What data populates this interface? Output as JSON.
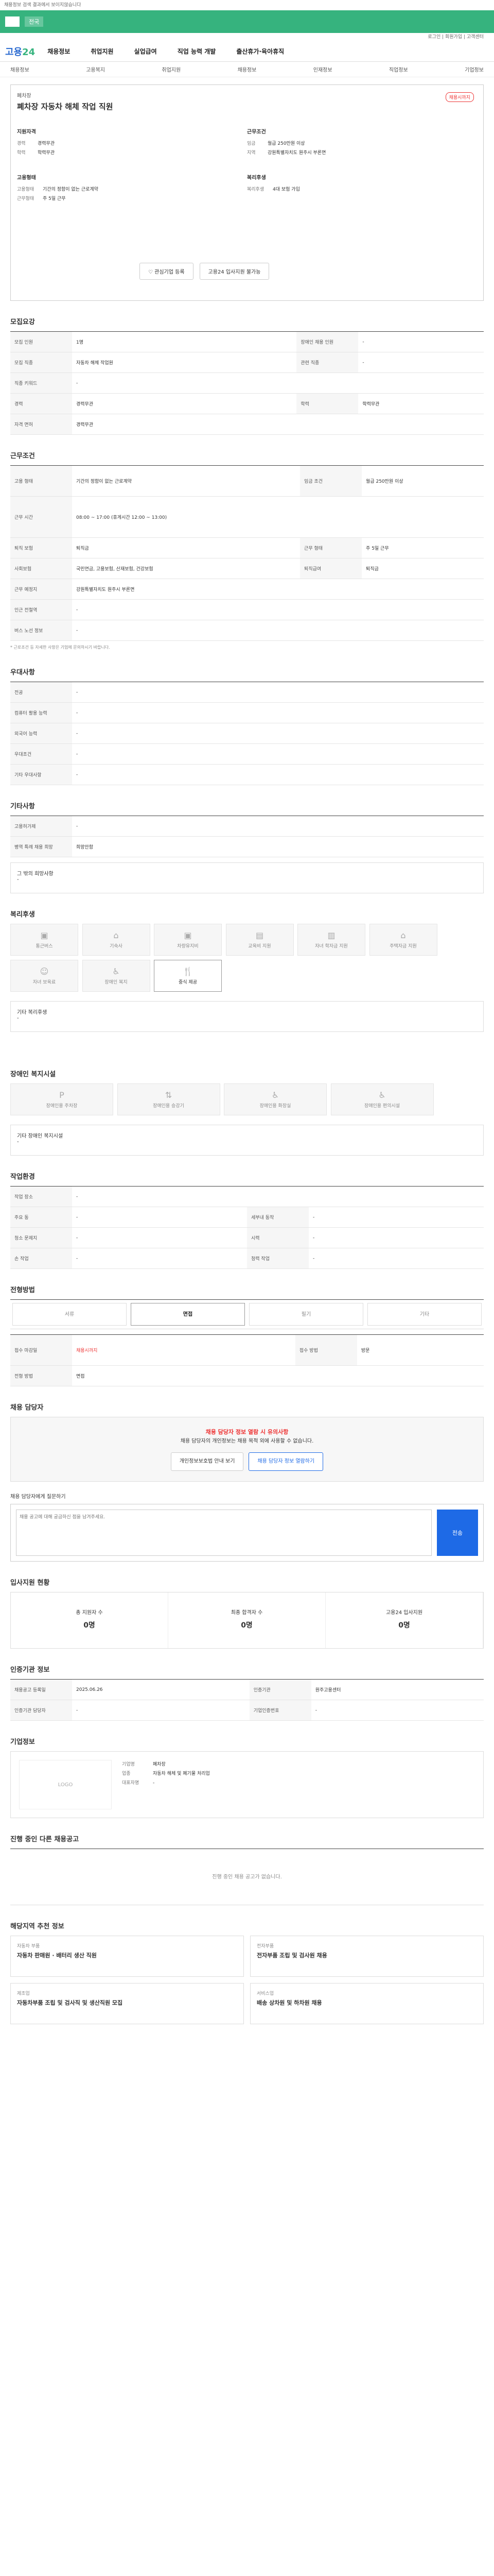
{
  "banner": "채용정보 검색 결과에서 보이지않습니다",
  "topbar": {
    "tag": "전국"
  },
  "util": "로그인 | 회원가입 | 고객센터",
  "header": {
    "logo_a": "고용",
    "logo_b": "24",
    "nav": [
      "채용정보",
      "취업지원",
      "실업급여",
      "직업 능력 개발",
      "출산휴가·육아휴직"
    ]
  },
  "subnav": [
    "채용정보",
    "고용복지",
    "취업지원",
    "채용정보",
    "인재정보",
    "직업정보",
    "기업정보"
  ],
  "summary": {
    "company": "폐차장",
    "title": "폐차장 자동차 해체 작업 직원",
    "urgent": "채용시까지",
    "left_h": "지원자격",
    "left": [
      {
        "k": "경력",
        "v": "경력무관"
      },
      {
        "k": "학력",
        "v": "학력무관"
      }
    ],
    "right_h": "근무조건",
    "right": [
      {
        "k": "임금",
        "v": "월급 250만원 이상"
      },
      {
        "k": "지역",
        "v": "강원특별자치도 원주시 부론면"
      }
    ],
    "left2_h": "고용형태",
    "left2": [
      {
        "k": "고용형태",
        "v": "기간의 정함이 없는 근로계약"
      },
      {
        "k": "근무형태",
        "v": "주 5일 근무"
      }
    ],
    "right2_h": "복리후생",
    "right2": [
      {
        "k": "복리후생",
        "v": "4대 보험 가입"
      }
    ],
    "btn_a": "관심기업 등록",
    "btn_b": "고용24 입사지원 불가능"
  },
  "recruit": {
    "h": "모집요강",
    "rows": [
      {
        "k": "모집 인원",
        "v": "1명",
        "k2": "장애인 채용 인원",
        "v2": "-"
      },
      {
        "k": "모집 직종",
        "v": "자동차 해체 작업원",
        "k2": "관련 직종",
        "v2": "-"
      },
      {
        "k": "직종 키워드",
        "v": "-"
      },
      {
        "k": "경력",
        "v": "경력무관",
        "k2": "학력",
        "v2": "학력무관"
      },
      {
        "k": "자격 면허",
        "v": "경력무관"
      }
    ]
  },
  "work": {
    "h": "근무조건",
    "rows": [
      {
        "k": "고용 형태",
        "v": "기간의 정함이 없는 근로계약",
        "k2": "임금 조건",
        "v2": "월급 250만원 이상"
      },
      {
        "k": "근무 시간",
        "v": "08:00 ~ 17:00 (휴게시간 12:00 ~ 13:00)"
      },
      {
        "k": "퇴직 보험",
        "v": "퇴직금",
        "k2": "근무 형태",
        "v2": "주 5일 근무"
      },
      {
        "k": "사회보험",
        "v": "국민연금, 고용보험, 산재보험, 건강보험",
        "k2": "퇴직급여",
        "v2": "퇴직금"
      },
      {
        "k": "근무 예정지",
        "v": "강원특별자치도 원주시 부론면"
      },
      {
        "k": "인근 전철역",
        "v": "-"
      },
      {
        "k": "버스 노선 정보",
        "v": "-"
      }
    ],
    "note": "* 근로조건 등 자세한 사항은 기업에 문의하시기 바랍니다."
  },
  "pref": {
    "h": "우대사항",
    "rows": [
      {
        "k": "전공",
        "v": "-"
      },
      {
        "k": "컴퓨터 활용 능력",
        "v": "-"
      },
      {
        "k": "외국어 능력",
        "v": "-"
      },
      {
        "k": "우대조건",
        "v": "-"
      },
      {
        "k": "기타 우대사항",
        "v": "-"
      }
    ]
  },
  "etc": {
    "h": "기타사항",
    "rows": [
      {
        "k": "고용허가제",
        "v": "-"
      },
      {
        "k": "병역 특례 채용 희망",
        "v": "희망안함"
      }
    ],
    "box": "그 밖의 희망사항",
    "box_v": "-"
  },
  "welfare": {
    "h": "복리후생",
    "items": [
      "통근버스",
      "기숙사",
      "차량유지비",
      "교육비 지원",
      "자녀 학자금 지원",
      "주택자금 지원",
      "자녀 보육료",
      "장애인 복지",
      "중식 제공"
    ],
    "box": "기타 복리후생",
    "box_v": "-"
  },
  "disab": {
    "h": "장애인 복지시설",
    "items": [
      "장애인용 주차장",
      "장애인용 승강기",
      "장애인용 화장실",
      "장애인용 편의시설"
    ],
    "box": "기타 장애인 복지시설",
    "box_v": "-"
  },
  "workenv": {
    "h": "작업환경",
    "rows": [
      {
        "k": "작업 장소",
        "v": "-"
      },
      {
        "k": "주요 동",
        "v": "-",
        "k2": "세부내 동작",
        "v2": "-"
      },
      {
        "k": "청소 문제지",
        "v": "-",
        "k2": "시력",
        "v2": "-"
      },
      {
        "k": "손 작업",
        "v": "-",
        "k2": "청력 작업",
        "v2": "-"
      }
    ]
  },
  "process": {
    "h": "전형방법",
    "tabs": [
      "서류",
      "면접",
      "필기",
      "기타"
    ],
    "rows": [
      {
        "k": "접수 마감일",
        "v": "채용시까지",
        "k2": "접수 방법",
        "v2": "방문"
      },
      {
        "k": "전형 방법",
        "v": "면접"
      }
    ]
  },
  "manager": {
    "h": "채용 담당자",
    "alert_t": "채용 담당자 정보 열람 시 유의사항",
    "alert": "채용 담당자의 개인정보는 채용 목적 외에 사용할 수 없습니다.",
    "btn_a": "개인정보보호법 안내 보기",
    "btn_b": "채용 담당자 정보 열람하기",
    "q_h": "채용 담당자에게 질문하기",
    "q_ph": "채용 공고에 대해 궁금하신 점을 남겨주세요.",
    "q_send": "전송"
  },
  "stats": {
    "h": "입사지원 현황",
    "items": [
      {
        "k": "총 지원자 수",
        "v": "0명"
      },
      {
        "k": "최종 합격자 수",
        "v": "0명"
      },
      {
        "k": "고용24 입사지원",
        "v": "0명"
      }
    ]
  },
  "cert": {
    "h": "인증기관 정보",
    "rows": [
      {
        "k": "채용공고 등록일",
        "v": "2025.06.26",
        "k2": "인증기관",
        "v2": "원주고용센터"
      },
      {
        "k": "인증기관 담당자",
        "v": "-",
        "k2": "기업인증번호",
        "v2": "-"
      }
    ]
  },
  "corp": {
    "h": "기업정보",
    "logo": "LOGO",
    "rows": [
      {
        "k": "기업명",
        "v": "폐차장"
      },
      {
        "k": "업종",
        "v": "자동차 해체 및 폐기물 처리업"
      },
      {
        "k": "대표자명",
        "v": "-"
      }
    ]
  },
  "others": {
    "h": "진행 중인 다른 채용공고",
    "empty": "진행 중인 채용 공고가 없습니다."
  },
  "recom": {
    "h": "해당지역 추천 정보",
    "cards": [
      {
        "c": "자동차 부품",
        "t": "자동차 판매원 · 배터리 생산 직원"
      },
      {
        "c": "전자부품",
        "t": "전자부품 조립 및 검사원 채용"
      },
      {
        "c": "제조업",
        "t": "자동차부품 조립 및 검사직 및 생산직원 모집"
      },
      {
        "c": "서비스업",
        "t": "배송 상차원 및 하차원 채용"
      }
    ]
  }
}
